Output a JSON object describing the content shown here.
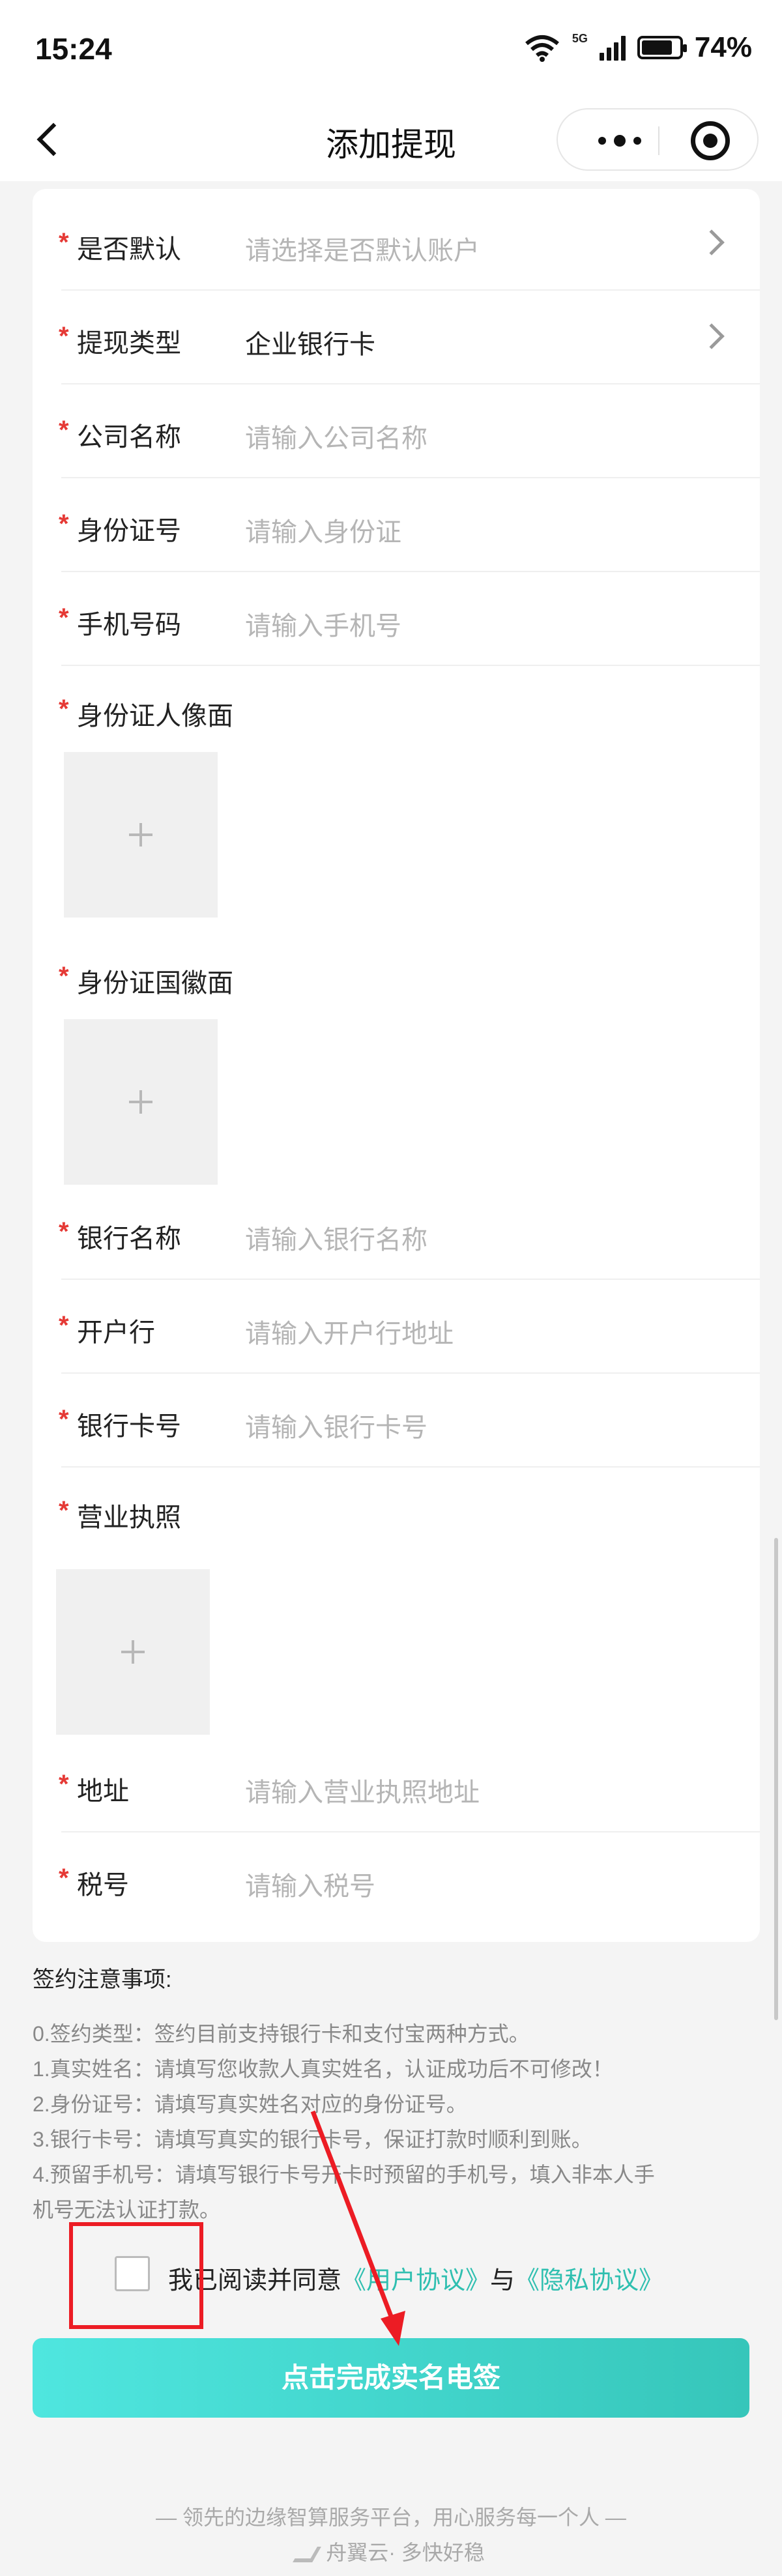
{
  "status_bar": {
    "time": "15:24",
    "network": "5G",
    "battery": "74%",
    "battery_level": 0.74
  },
  "nav": {
    "title": "添加提现",
    "back_icon": "chevron-left-icon",
    "more_icon": "more-dots-icon",
    "close_icon": "target-icon"
  },
  "form": {
    "default": {
      "label": "是否默认",
      "placeholder": "请选择是否默认账户"
    },
    "type": {
      "label": "提现类型",
      "value": "企业银行卡"
    },
    "company": {
      "label": "公司名称",
      "placeholder": "请输入公司名称"
    },
    "id_number": {
      "label": "身份证号",
      "placeholder": "请输入身份证"
    },
    "phone": {
      "label": "手机号码",
      "placeholder": "请输入手机号"
    },
    "id_front": {
      "label": "身份证人像面"
    },
    "id_back": {
      "label": "身份证国徽面"
    },
    "bank_name": {
      "label": "银行名称",
      "placeholder": "请输入银行名称"
    },
    "branch": {
      "label": "开户行",
      "placeholder": "请输入开户行地址"
    },
    "card_number": {
      "label": "银行卡号",
      "placeholder": "请输入银行卡号"
    },
    "license": {
      "label": "营业执照"
    },
    "address": {
      "label": "地址",
      "placeholder": "请输入营业执照地址"
    },
    "tax": {
      "label": "税号",
      "placeholder": "请输入税号"
    },
    "required_mark": "*",
    "upload_plus": "+"
  },
  "notice": {
    "title": "签约注意事项:",
    "lines": [
      "0.签约类型：签约目前支持银行卡和支付宝两种方式。",
      "1.真实姓名：请填写您收款人真实姓名，认证成功后不可修改！",
      "2.身份证号：请填写真实姓名对应的身份证号。",
      "3.银行卡号：请填写真实的银行卡号，保证打款时顺利到账。",
      "4.预留手机号：请填写银行卡号开卡时预留的手机号，填入非本人手",
      "机号无法认证打款。"
    ]
  },
  "agreement": {
    "prefix": "我已阅读并同意",
    "user_link": "《用户协议》",
    "and": "与",
    "privacy_link": "《隐私协议》"
  },
  "submit_label": "点击完成实名电签",
  "footer": {
    "slogan": "— 领先的边缘智算服务平台，用心服务每一个人 —",
    "brand": "舟翼云· 多快好稳"
  },
  "colors": {
    "accent": "#36c6ba",
    "required": "#e53935",
    "annotation": "#ec1c24"
  }
}
